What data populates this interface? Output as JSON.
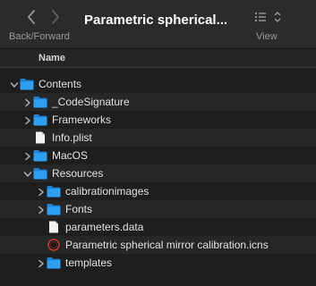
{
  "toolbar": {
    "back_icon": "chevron-left-icon",
    "forward_icon": "chevron-right-icon",
    "nav_label": "Back/Forward",
    "title": "Parametric spherical...",
    "view_icon": "list-view-icon",
    "view_label": "View"
  },
  "columns": {
    "name": "Name"
  },
  "rows": [
    {
      "name": "Contents",
      "type": "folder",
      "depth": 0,
      "expanded": true
    },
    {
      "name": "_CodeSignature",
      "type": "folder",
      "depth": 1,
      "expanded": false
    },
    {
      "name": "Frameworks",
      "type": "folder",
      "depth": 1,
      "expanded": false
    },
    {
      "name": "Info.plist",
      "type": "file",
      "depth": 1
    },
    {
      "name": "MacOS",
      "type": "folder",
      "depth": 1,
      "expanded": false
    },
    {
      "name": "Resources",
      "type": "folder",
      "depth": 1,
      "expanded": true
    },
    {
      "name": "calibrationimages",
      "type": "folder",
      "depth": 2,
      "expanded": false
    },
    {
      "name": "Fonts",
      "type": "folder",
      "depth": 2,
      "expanded": false
    },
    {
      "name": "parameters.data",
      "type": "file",
      "depth": 2
    },
    {
      "name": "Parametric spherical mirror calibration.icns",
      "type": "icns",
      "depth": 2
    },
    {
      "name": "templates",
      "type": "folder",
      "depth": 2,
      "expanded": false
    }
  ],
  "colors": {
    "folder": "#2f9ff3",
    "background": "#1e1e1e",
    "toolbar": "#2b2b2b",
    "icns_ring": "#d43a2f"
  }
}
